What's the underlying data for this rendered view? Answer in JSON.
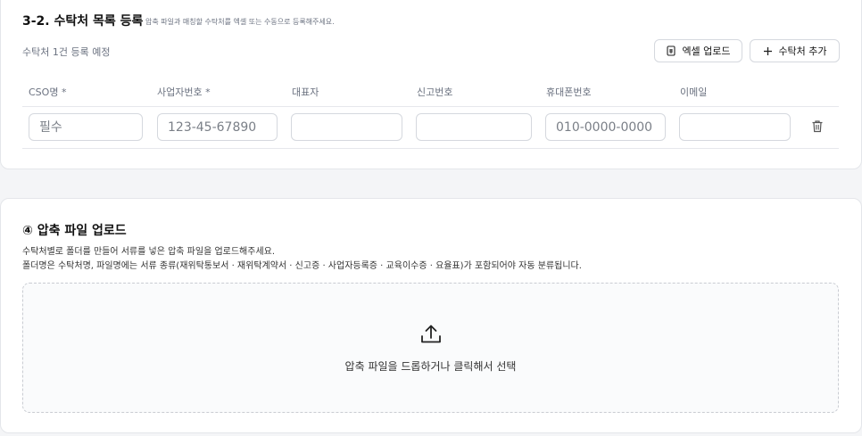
{
  "section_cso": {
    "title": "3-2. 수탁처 목록 등록",
    "description": "압축 파일과 매칭할 수탁처를 엑셀 또는 수동으로 등록해주세요.",
    "count_status": "수탁처 1건 등록 예정",
    "excel_upload_label": "엑셀 업로드",
    "add_cso_label": "수탁처 추가",
    "columns": [
      "CSO명 *",
      "사업자번호 *",
      "대표자",
      "신고번호",
      "휴대폰번호",
      "이메일"
    ],
    "row": {
      "cso_name": {
        "value": "",
        "placeholder": "필수"
      },
      "business_no": {
        "value": "",
        "placeholder": "123-45-67890"
      },
      "representative": {
        "value": "",
        "placeholder": ""
      },
      "report_no": {
        "value": "",
        "placeholder": ""
      },
      "mobile": {
        "value": "",
        "placeholder": "010-0000-0000"
      },
      "email": {
        "value": "",
        "placeholder": ""
      }
    }
  },
  "section_zip": {
    "title": "④ 압축 파일 업로드",
    "description_line1": "수탁처별로 폴더를 만들어 서류를 넣은 압축 파일을 업로드해주세요.",
    "description_line2": "폴더명은 수탁처명, 파일명에는 서류 종류(재위탁통보서 · 재위탁계약서 · 신고증 · 사업자등록증 · 교육이수증 · 요율표)가 포함되어야 자동 분류됩니다.",
    "dropzone_text": "압축 파일을 드롭하거나 클릭해서 선택"
  },
  "icons": {
    "excel": "spreadsheet-file-icon",
    "add": "plus-icon",
    "delete": "trash-icon",
    "upload": "upload-icon"
  }
}
